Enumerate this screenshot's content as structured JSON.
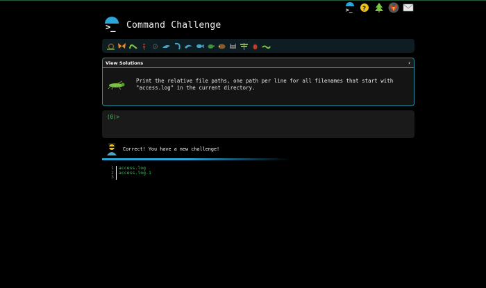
{
  "top_nav": {
    "icons": [
      "terminal-icon",
      "help-icon",
      "tree-icon",
      "gitlab-icon",
      "mail-icon"
    ]
  },
  "header": {
    "title": "Command Challenge"
  },
  "critters": [
    "snail",
    "butterfly",
    "caterpillar",
    "ant",
    "ladybug-small",
    "bird",
    "shrimp",
    "dolphin",
    "fish",
    "turtle",
    "hedgehog",
    "cat",
    "dragonfly",
    "beetle",
    "worm"
  ],
  "challenge": {
    "view_solutions_label": "View Solutions",
    "chevron": "›",
    "description": "Print the relative file paths, one path per line for all filenames that start with \"access.log\" in the current directory."
  },
  "terminal": {
    "prompt": "(0)>"
  },
  "feedback": {
    "message": "Correct! You have a new challenge!"
  },
  "output": {
    "line_numbers": [
      "1",
      "2",
      "3"
    ],
    "lines": [
      "access.log",
      "access.log.1",
      ""
    ]
  },
  "colors": {
    "accent": "#2aa6d9",
    "prompt_green": "#35c85a",
    "panel_border": "#2a8fa0"
  }
}
